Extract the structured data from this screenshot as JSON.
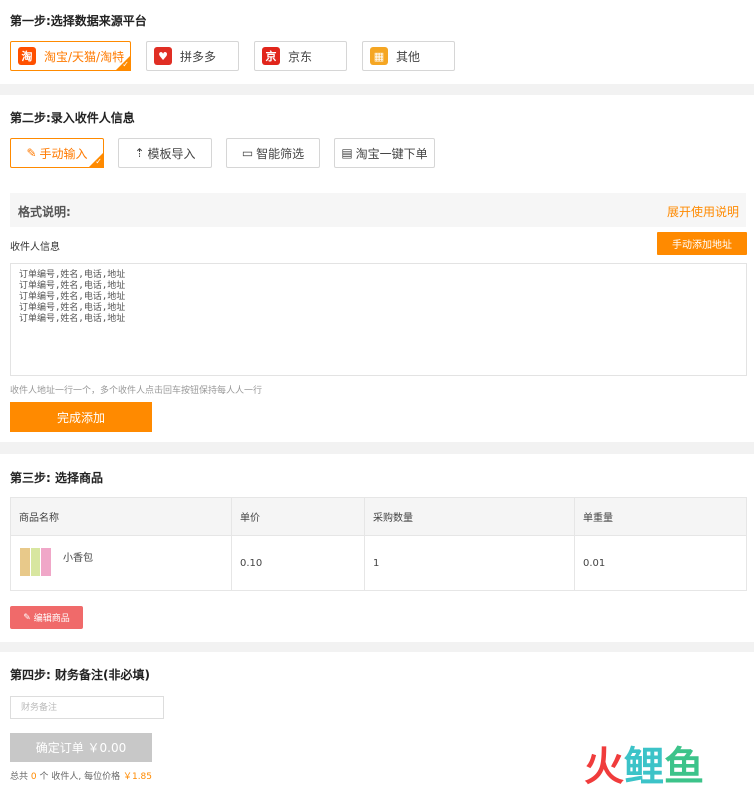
{
  "step1": {
    "title": "第一步:选择数据来源平台",
    "platforms": [
      {
        "label": "淘宝/天猫/淘特",
        "icon": "taobao-icon",
        "icon_text": "淘",
        "color": "#ff5000",
        "active": true
      },
      {
        "label": "拼多多",
        "icon": "pinduoduo-icon",
        "icon_text": "♥",
        "color": "#e02e24",
        "active": false
      },
      {
        "label": "京东",
        "icon": "jd-icon",
        "icon_text": "京",
        "color": "#e1251b",
        "active": false
      },
      {
        "label": "其他",
        "icon": "other-icon",
        "icon_text": "▦",
        "color": "#f5a623",
        "active": false
      }
    ]
  },
  "step2": {
    "title": "第二步:录入收件人信息",
    "modes": [
      {
        "label": "手动输入",
        "icon": "pencil-icon",
        "glyph": "✎",
        "active": true
      },
      {
        "label": "模板导入",
        "icon": "upload-icon",
        "glyph": "⇡",
        "active": false
      },
      {
        "label": "智能筛选",
        "icon": "monitor-icon",
        "glyph": "▭",
        "active": false
      },
      {
        "label": "淘宝一键下单",
        "icon": "document-icon",
        "glyph": "▤",
        "active": false
      }
    ],
    "format_title": "格式说明:",
    "expand_label": "展开使用说明",
    "recipient_label": "收件人信息",
    "add_address_label": "手动添加地址",
    "textarea_lines": [
      "订单编号,姓名,电话,地址",
      "订单编号,姓名,电话,地址",
      "订单编号,姓名,电话,地址",
      "订单编号,姓名,电话,地址",
      "订单编号,姓名,电话,地址"
    ],
    "hint": "收件人地址一行一个，多个收件人点击回车按钮保持每人人一行",
    "done_label": "完成添加"
  },
  "step3": {
    "title": "第三步: 选择商品",
    "columns": [
      "商品名称",
      "单价",
      "采购数量",
      "单重量"
    ],
    "rows": [
      {
        "name": "小香包",
        "price": "0.10",
        "qty": "1",
        "weight": "0.01"
      }
    ],
    "edit_label": "编辑商品"
  },
  "step4": {
    "title": "第四步: 财务备注(非必填)",
    "memo_placeholder": "财务备注",
    "memo_value": "",
    "confirm_label": "确定订单 ￥0.00",
    "summary_prefix": "总共",
    "summary_count": "0",
    "summary_mid": "个 收件人,  每位价格",
    "summary_price": "￥1.85"
  },
  "watermark": {
    "chars": [
      {
        "text": "火",
        "color": "#f03c3c"
      },
      {
        "text": "鲤",
        "color": "#3cc3c8"
      },
      {
        "text": "鱼",
        "color": "#3cc38a"
      }
    ]
  },
  "colors": {
    "accent": "#ff8a00",
    "edit_button": "#f06a6a",
    "disabled": "#c8c8c8"
  }
}
